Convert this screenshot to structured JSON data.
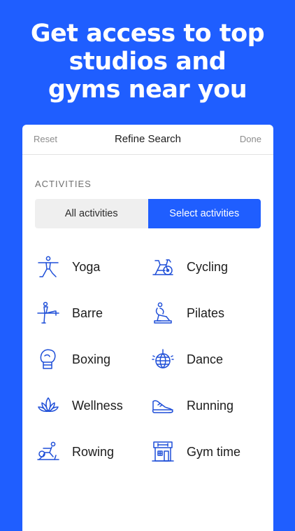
{
  "headline": {
    "line1": "Get access to top",
    "line2": "studios and",
    "line3": "gyms near you"
  },
  "header": {
    "reset": "Reset",
    "title": "Refine Search",
    "done": "Done"
  },
  "section_label": "ACTIVITIES",
  "segmented": {
    "all": "All activities",
    "select": "Select activities",
    "selected": "select"
  },
  "activities": [
    {
      "label": "Yoga",
      "icon": "yoga-icon"
    },
    {
      "label": "Cycling",
      "icon": "cycling-icon"
    },
    {
      "label": "Barre",
      "icon": "barre-icon"
    },
    {
      "label": "Pilates",
      "icon": "pilates-icon"
    },
    {
      "label": "Boxing",
      "icon": "boxing-glove-icon"
    },
    {
      "label": "Dance",
      "icon": "disco-ball-icon"
    },
    {
      "label": "Wellness",
      "icon": "lotus-icon"
    },
    {
      "label": "Running",
      "icon": "running-shoe-icon"
    },
    {
      "label": "Rowing",
      "icon": "rowing-icon"
    },
    {
      "label": "Gym time",
      "icon": "gym-building-icon"
    }
  ],
  "colors": {
    "brand_blue": "#1f5eff",
    "icon_blue": "#1f4fd8"
  }
}
